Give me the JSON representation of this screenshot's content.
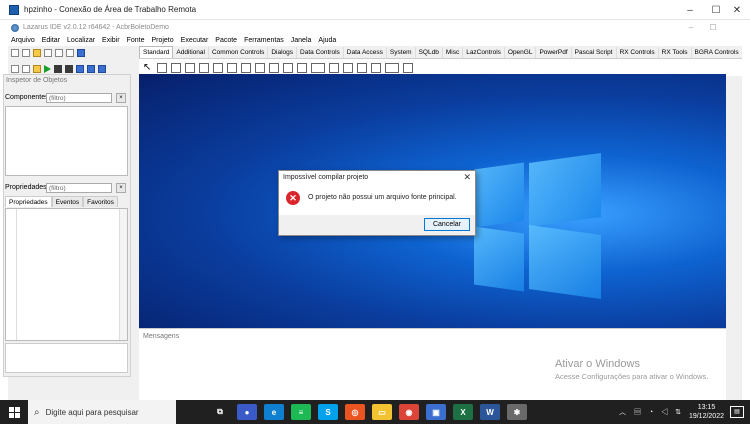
{
  "rdp_window": {
    "title": "hpzinho - Conexão de Área de Trabalho Remota",
    "controls": [
      "–",
      "☐",
      "✕"
    ]
  },
  "ide": {
    "title": "Lazarus IDE v2.0.12 r64642 - AcbrBoletoDemo",
    "controls": [
      "–",
      "☐"
    ],
    "menu": [
      "Arquivo",
      "Editar",
      "Localizar",
      "Exibir",
      "Fonte",
      "Projeto",
      "Executar",
      "Pacote",
      "Ferramentas",
      "Janela",
      "Ajuda"
    ],
    "palette_tabs": [
      "Standard",
      "Additional",
      "Common Controls",
      "Dialogs",
      "Data Controls",
      "Data Access",
      "System",
      "SQLdb",
      "Misc",
      "LazControls",
      "OpenGL",
      "PowerPdf",
      "Pascal Script",
      "RX Controls",
      "RX Tools",
      "BGRA Controls"
    ],
    "active_palette_tab": "Standard"
  },
  "inspector": {
    "title": "Inspetor de Objetos",
    "components_label": "Componentes",
    "components_filter": "(filtro)",
    "properties_label": "Propriedades",
    "properties_filter": "(filtro)",
    "tabs": [
      "Propriedades",
      "Eventos",
      "Favoritos"
    ],
    "active_tab": "Propriedades"
  },
  "messages": {
    "label": "Mensagens"
  },
  "watermark": {
    "title": "Ativar o Windows",
    "subtitle": "Acesse Configurações para ativar o Windows."
  },
  "dialog": {
    "title": "Impossível compilar projeto",
    "message": "O projeto não possui um arquivo fonte principal.",
    "button": "Cancelar",
    "icon": "error-icon",
    "icon_glyph": "✕"
  },
  "taskbar": {
    "search_placeholder": "Digite aqui para pesquisar",
    "clock_time": "13:15",
    "clock_date": "19/12/2022",
    "apps": [
      {
        "name": "task-view",
        "glyph": "⧉",
        "color": "#202020"
      },
      {
        "name": "chat-icon",
        "glyph": "●",
        "color": "#3a5ac8"
      },
      {
        "name": "edge-icon",
        "glyph": "e",
        "color": "#0f7fd0"
      },
      {
        "name": "spotify-icon",
        "glyph": "≡",
        "color": "#1db954"
      },
      {
        "name": "skype-icon",
        "glyph": "S",
        "color": "#00a2ed"
      },
      {
        "name": "ubuntu-icon",
        "glyph": "◎",
        "color": "#e95420"
      },
      {
        "name": "files-icon",
        "glyph": "▭",
        "color": "#f2c230"
      },
      {
        "name": "chrome-icon",
        "glyph": "◉",
        "color": "#db4437"
      },
      {
        "name": "remote-desktop-icon",
        "glyph": "▣",
        "color": "#3a6fcf"
      },
      {
        "name": "excel-icon",
        "glyph": "X",
        "color": "#1d7044"
      },
      {
        "name": "word-icon",
        "glyph": "W",
        "color": "#2b579a"
      },
      {
        "name": "settings-app-icon",
        "glyph": "✱",
        "color": "#6a6a6a"
      }
    ]
  }
}
